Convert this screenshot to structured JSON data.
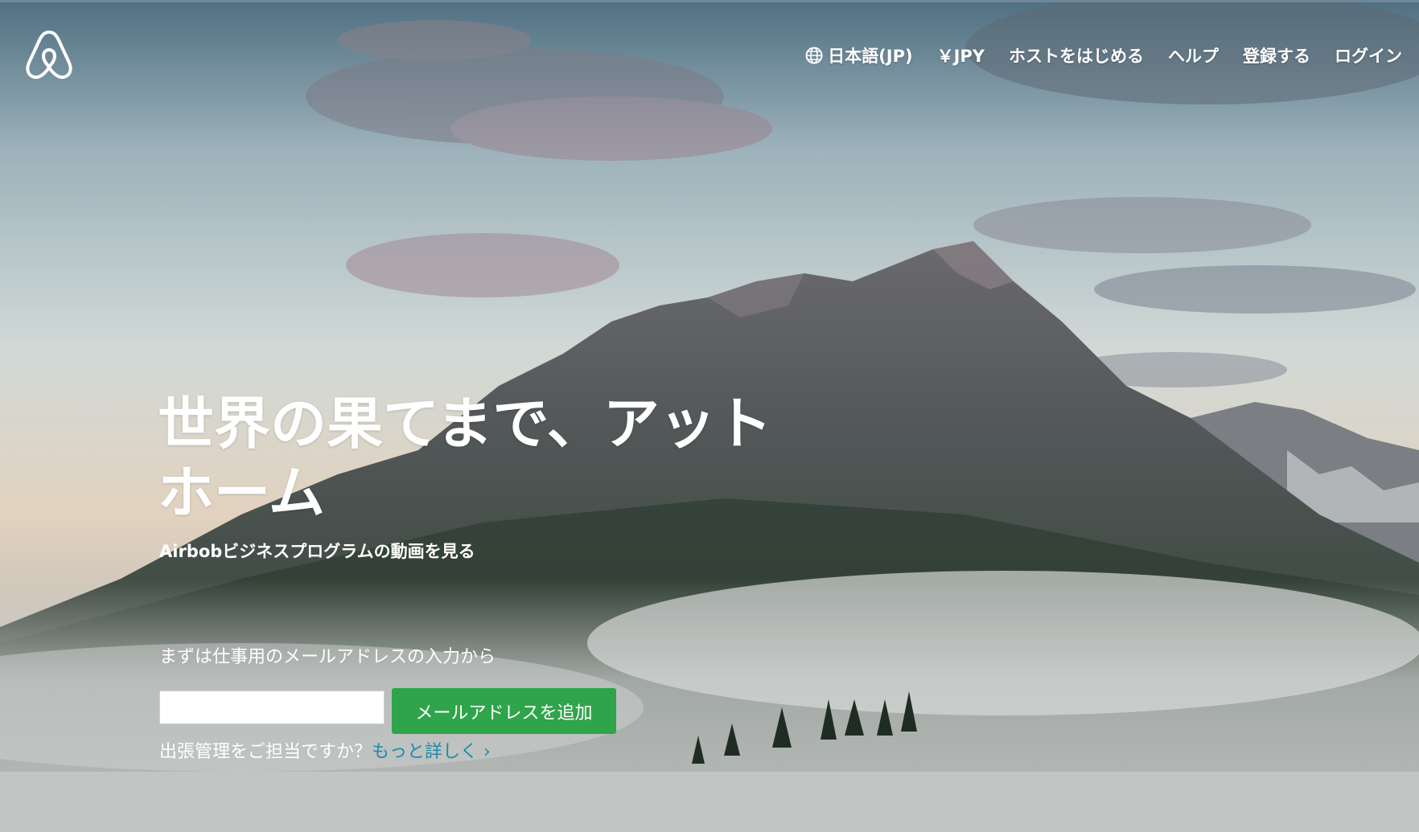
{
  "brand": {
    "logo_icon": "airbnb-belo-icon"
  },
  "nav": {
    "language": "日本語(JP)",
    "currency": "￥JPY",
    "host": "ホストをはじめる",
    "help": "ヘルプ",
    "signup": "登録する",
    "login": "ログイン"
  },
  "hero": {
    "headline_line1": "世界の果てまで、アット",
    "headline_line2": "ホーム",
    "video_link": "Airbobビジネスプログラムの動画を見る",
    "prompt": "まずは仕事用のメールアドレスの入力から",
    "email_value": "",
    "add_button": "メールアドレスを追加",
    "manager_question": "出張管理をご担当ですか？",
    "more_link": "もっと詳しく ›"
  },
  "colors": {
    "button_green": "#2fa44a",
    "link_teal": "#1f8aa8",
    "text_white": "#ffffff"
  }
}
